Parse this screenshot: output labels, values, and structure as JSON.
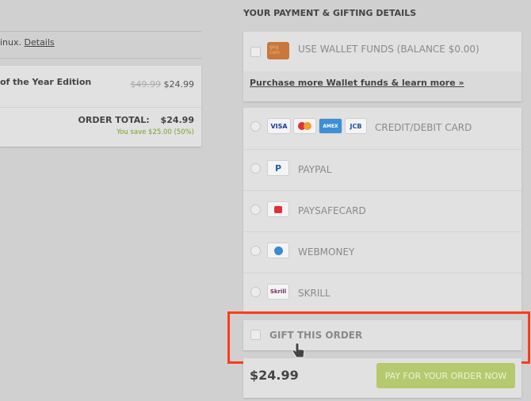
{
  "left": {
    "platform_text": "inux.",
    "details_link": "Details",
    "item_title": "of the Year Edition",
    "old_price": "$49.99",
    "price": "$24.99",
    "order_total_label": "ORDER TOTAL:",
    "order_total": "$24.99",
    "savings": "You save $25.00 (50%)"
  },
  "right": {
    "heading": "YOUR PAYMENT & GIFTING DETAILS",
    "wallet_label": "USE WALLET FUNDS (BALANCE $0.00)",
    "wallet_link": "Purchase more Wallet funds & learn more »",
    "methods": [
      {
        "label": "CREDIT/DEBIT CARD"
      },
      {
        "label": "PAYPAL"
      },
      {
        "label": "PAYSAFECARD"
      },
      {
        "label": "WEBMONEY"
      },
      {
        "label": "SKRILL"
      }
    ],
    "card_icons": [
      "VISA",
      "MC",
      "AMEX",
      "JCB"
    ],
    "skrill_icon": "Skrill",
    "wallet_icon_text": "gog com",
    "gift_label": "GIFT THIS ORDER",
    "total": "$24.99",
    "pay_button": "PAY FOR YOUR ORDER NOW"
  },
  "colors": {
    "highlight": "#ff3b1a",
    "pay_button": "#b5c96e",
    "savings": "#7aa02a"
  }
}
